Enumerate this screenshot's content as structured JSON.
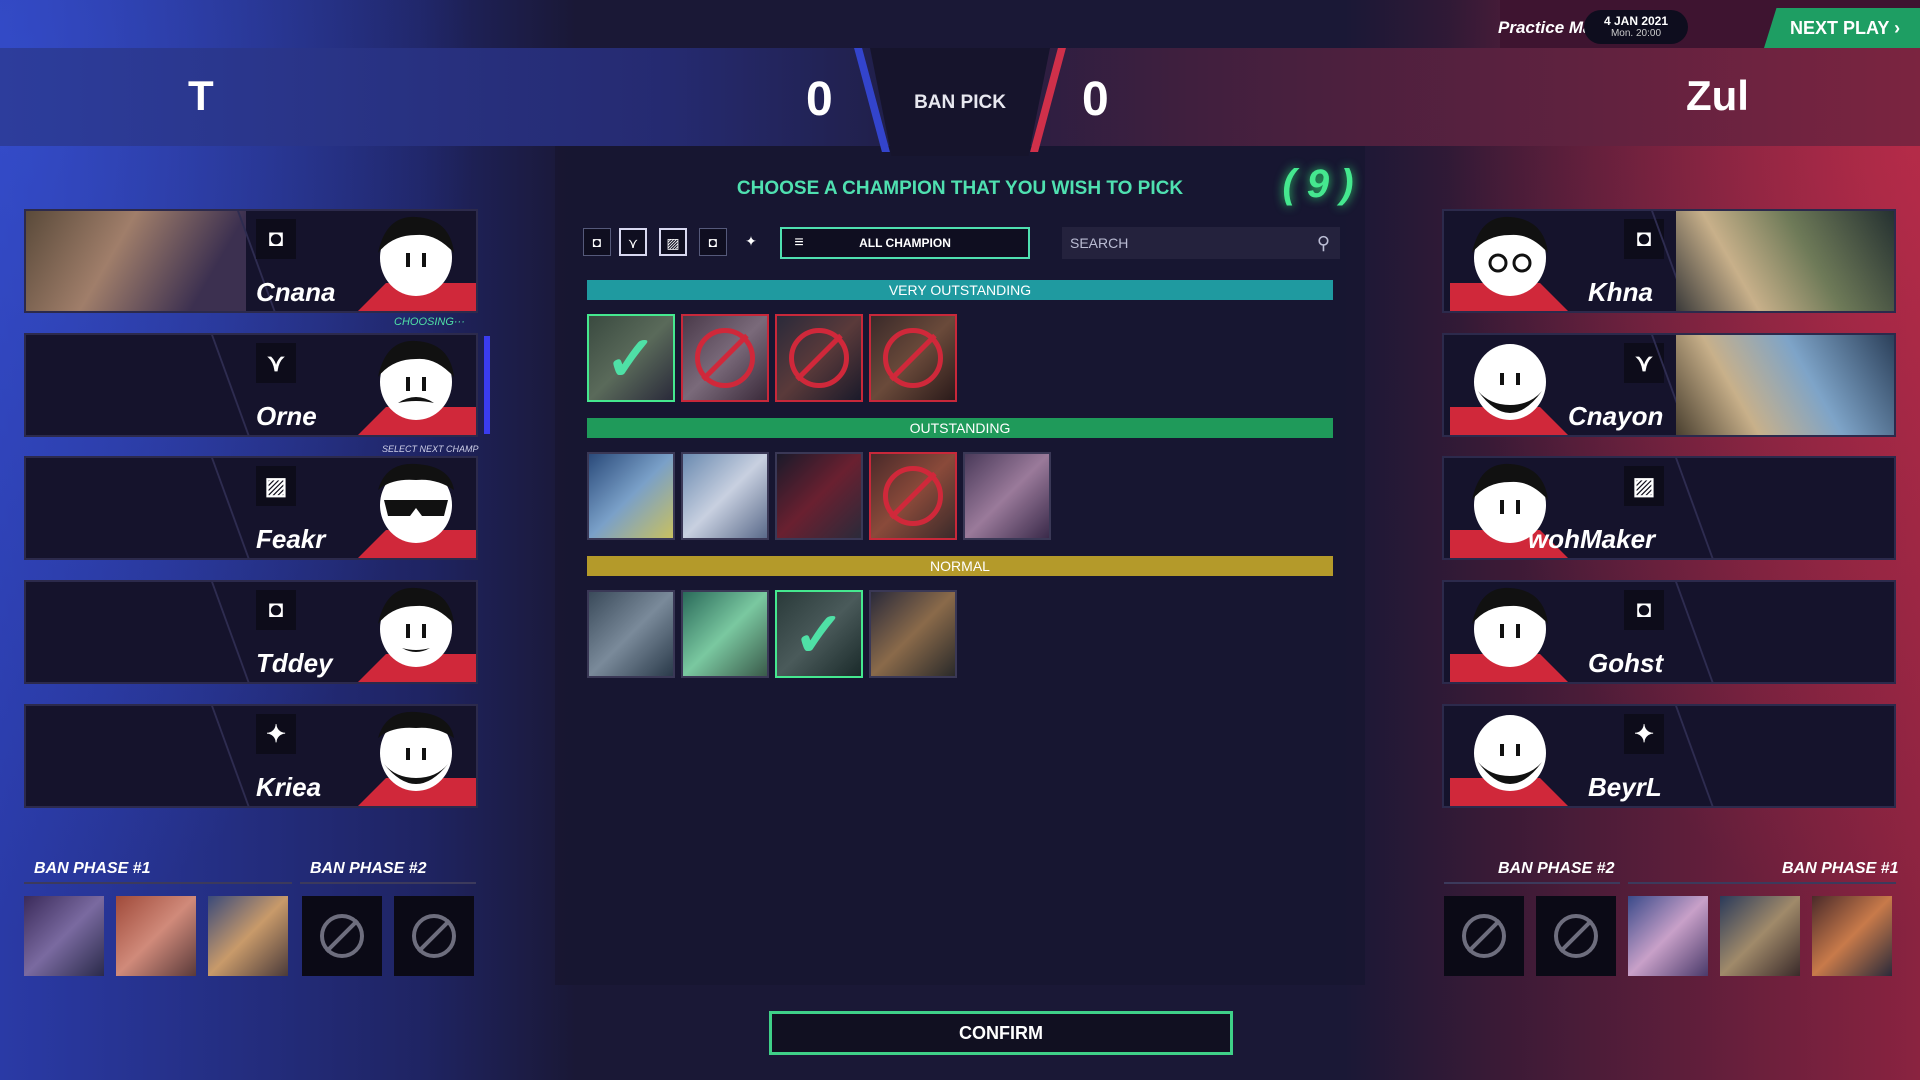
{
  "header": {
    "left_team": "T",
    "right_team": "Zul",
    "left_score": "0",
    "right_score": "0",
    "phase_label": "BAN PICK",
    "match_type": "Practice Match",
    "date_line1": "4 JAN 2021",
    "date_line2": "Mon. 20:00",
    "next_button": "NEXT PLAY"
  },
  "left_players": [
    {
      "name": "Cnana",
      "role_icon": "square-role-icon",
      "status": ""
    },
    {
      "name": "Orne",
      "role_icon": "claw-role-icon",
      "status": "CHOOSING···"
    },
    {
      "name": "Feakr",
      "role_icon": "slash-role-icon",
      "status": "SELECT NEXT CHAMP"
    },
    {
      "name": "Tddey",
      "role_icon": "square-role-icon",
      "status": ""
    },
    {
      "name": "Kriea",
      "role_icon": "wings-role-icon",
      "status": ""
    }
  ],
  "right_players": [
    {
      "name": "Khna",
      "role_icon": "square-role-icon"
    },
    {
      "name": "Cnayon",
      "role_icon": "claw-role-icon"
    },
    {
      "name": "wohMaker",
      "role_icon": "slash-role-icon"
    },
    {
      "name": "Gohst",
      "role_icon": "square-role-icon"
    },
    {
      "name": "BeyrL",
      "role_icon": "wings-role-icon"
    }
  ],
  "center": {
    "instruction": "CHOOSE A CHAMPION THAT YOU WISH TO PICK",
    "timer": "9",
    "filter_all": "ALL CHAMPION",
    "search_placeholder": "SEARCH",
    "tiers": [
      {
        "label": "VERY OUTSTANDING",
        "color": "#1f9aa0"
      },
      {
        "label": "OUTSTANDING",
        "color": "#1f9a5a"
      },
      {
        "label": "NORMAL",
        "color": "#b49a2a"
      }
    ]
  },
  "ban_phase": {
    "left_phase1": "BAN PHASE #1",
    "left_phase2": "BAN PHASE #2",
    "right_phase2": "BAN PHASE #2",
    "right_phase1": "BAN PHASE #1"
  },
  "confirm_label": "CONFIRM",
  "colors": {
    "accent_green": "#45e88f",
    "ban_red": "#d0283a",
    "team_blue": "#2d3d9c",
    "team_red": "#8a2340"
  }
}
